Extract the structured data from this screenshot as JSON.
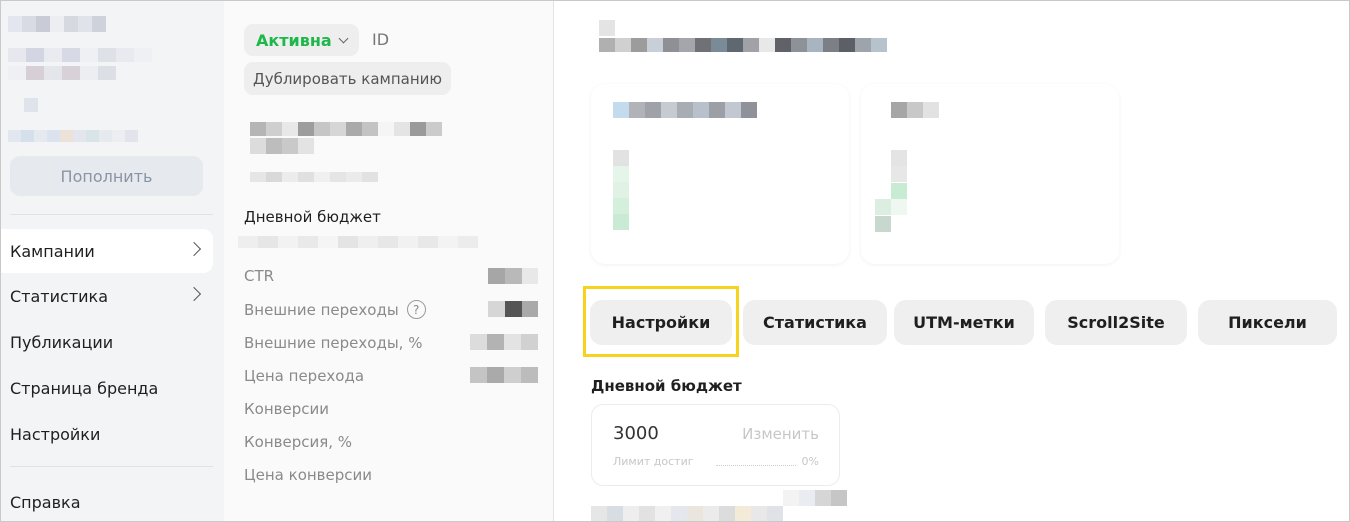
{
  "sidebar": {
    "topup_label": "Пополнить",
    "items": [
      {
        "label": "Кампании",
        "has_chevron": true,
        "active": true
      },
      {
        "label": "Статистика",
        "has_chevron": true,
        "active": false
      },
      {
        "label": "Публикации",
        "has_chevron": false,
        "active": false
      },
      {
        "label": "Страница бренда",
        "has_chevron": false,
        "active": false
      },
      {
        "label": "Настройки",
        "has_chevron": false,
        "active": false
      }
    ],
    "help_label": "Справка"
  },
  "campaign": {
    "status": "Активна",
    "status_color": "#1db74a",
    "id_label": "ID",
    "duplicate_label": "Дублировать кампанию",
    "daily_budget_heading": "Дневной бюджет",
    "metrics": [
      "CTR",
      "Внешние переходы",
      "Внешние переходы, %",
      "Цена перехода",
      "Конверсии",
      "Конверсия, %",
      "Цена конверсии"
    ]
  },
  "tabs": [
    {
      "label": "Настройки",
      "selected": true
    },
    {
      "label": "Статистика",
      "selected": false
    },
    {
      "label": "UTM-метки",
      "selected": false
    },
    {
      "label": "Scroll2Site",
      "selected": false
    },
    {
      "label": "Пиксели",
      "selected": false
    }
  ],
  "budget": {
    "title": "Дневной бюджет",
    "value": "3000",
    "change_label": "Изменить",
    "limit_label": "Лимит достиг",
    "percent": "0%"
  },
  "colors": {
    "highlight": "#f6d31f",
    "sidebar_bg": "#f3f4f6"
  }
}
